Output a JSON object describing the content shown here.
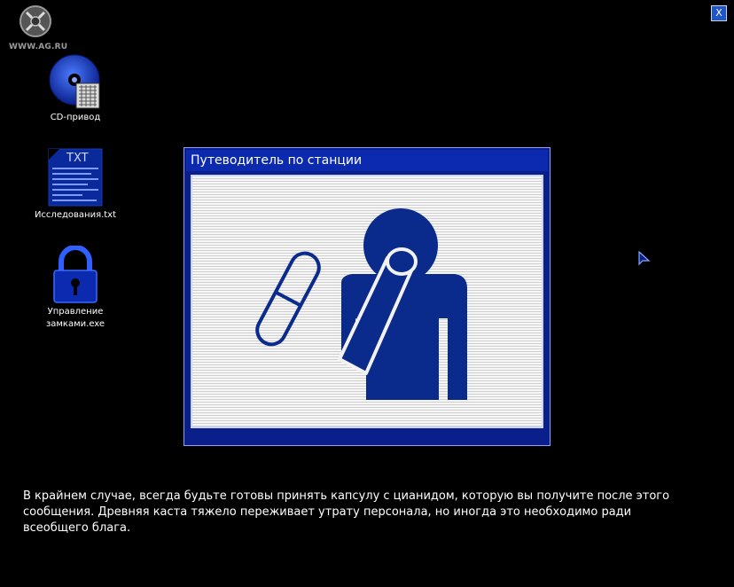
{
  "watermark": {
    "text": "WWW.AG.RU"
  },
  "close_button": {
    "label": "X"
  },
  "desktop_icons": [
    {
      "label": "CD-привод",
      "icon": "cd-drive-icon"
    },
    {
      "label": "Исследования.txt",
      "icon": "text-file-icon",
      "badge": "TXT"
    },
    {
      "label_line1": "Управление",
      "label_line2": "замками.exe",
      "icon": "padlock-icon"
    }
  ],
  "window": {
    "title": "Путеводитель по станции",
    "illustration": "person-swallowing-capsule"
  },
  "message": "В крайнем случае, всегда будьте готовы принять капсулу с цианидом, которую вы получите после этого сообщения. Древняя каста тяжело переживает утрату персонала, но иногда это необходимо ради всеобщего блага.",
  "colors": {
    "background": "#000000",
    "window_frame": "#0a1f8a",
    "title_bar": "#0c2ab0",
    "pictogram": "#0a2a8c",
    "text": "#ffffff"
  }
}
